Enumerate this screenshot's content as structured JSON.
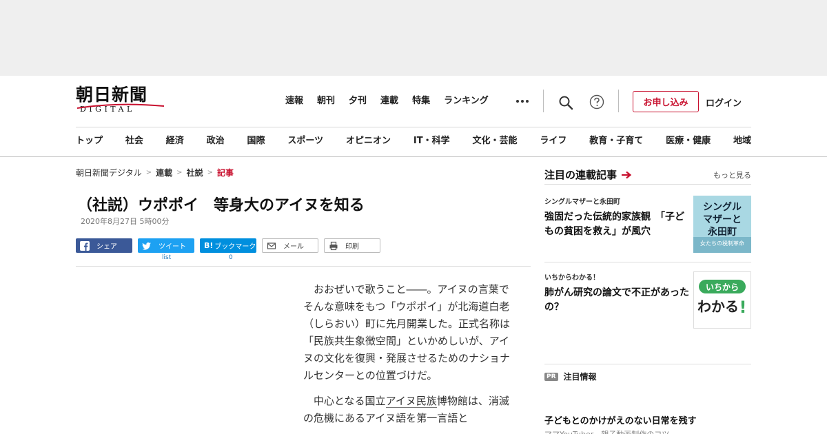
{
  "header": {
    "logo_text": "朝日新聞",
    "logo_sub": "DIGITAL",
    "topnav": [
      "速報",
      "朝刊",
      "夕刊",
      "連載",
      "特集",
      "ランキング"
    ],
    "apply_label": "お申し込み",
    "login_label": "ログイン",
    "categories": [
      "トップ",
      "社会",
      "経済",
      "政治",
      "国際",
      "スポーツ",
      "オピニオン",
      "IT・科学",
      "文化・芸能",
      "ライフ",
      "教育・子育て",
      "医療・健康",
      "地域"
    ],
    "accent_color": "#c8102e"
  },
  "breadcrumb": {
    "items": [
      "朝日新聞デジタル",
      "連載",
      "社説",
      "記事"
    ]
  },
  "article": {
    "title": "（社説）ウポポイ　等身大のアイヌを知る",
    "date": "2020年8月27日 5時00分",
    "share": {
      "facebook": "シェア",
      "twitter": "ツイート",
      "twitter_count": "list",
      "hatena": "ブックマーク",
      "hatena_count": "0",
      "mail": "メール",
      "print": "印刷"
    },
    "paragraph1": "おおぜいで歌うこと――。アイヌの言葉でそんな意味をもつ「ウポポイ」が北海道白老（しらおい）町に先月開業した。正式名称は「民族共生象徴空間」といかめしいが、アイヌの文化を復興・発展させるためのナショナルセンターとの位置づけだ。",
    "paragraph2_pre": "中心となる国立",
    "paragraph2_link": "アイヌ民族",
    "paragraph2_post": "博物館は、消滅の危機にあるアイヌ語を第一言語と"
  },
  "sidebar": {
    "heading": "注目の連載記事",
    "more": "もっと見る",
    "cards": [
      {
        "series": "シングルマザーと永田町",
        "title": "強固だった伝統的家族観　「子どもの貧困を救え」が風穴",
        "thumb_line1": "シングル",
        "thumb_line2": "マザーと",
        "thumb_line3": "永田町",
        "thumb_sub": "女たちの税制革命"
      },
      {
        "series": "いちからわかる！",
        "title": "肺がん研究の論文で不正があったの？",
        "thumb_line1": "いちから",
        "thumb_line2": "わかる",
        "thumb_excl": "!"
      }
    ],
    "pr_tag": "PR",
    "pr_label": "注目情報",
    "pr_title": "子どもとのかけがえのない日常を残す",
    "pr_sub": "ママYouTuber　親子動画制作のコツ"
  }
}
